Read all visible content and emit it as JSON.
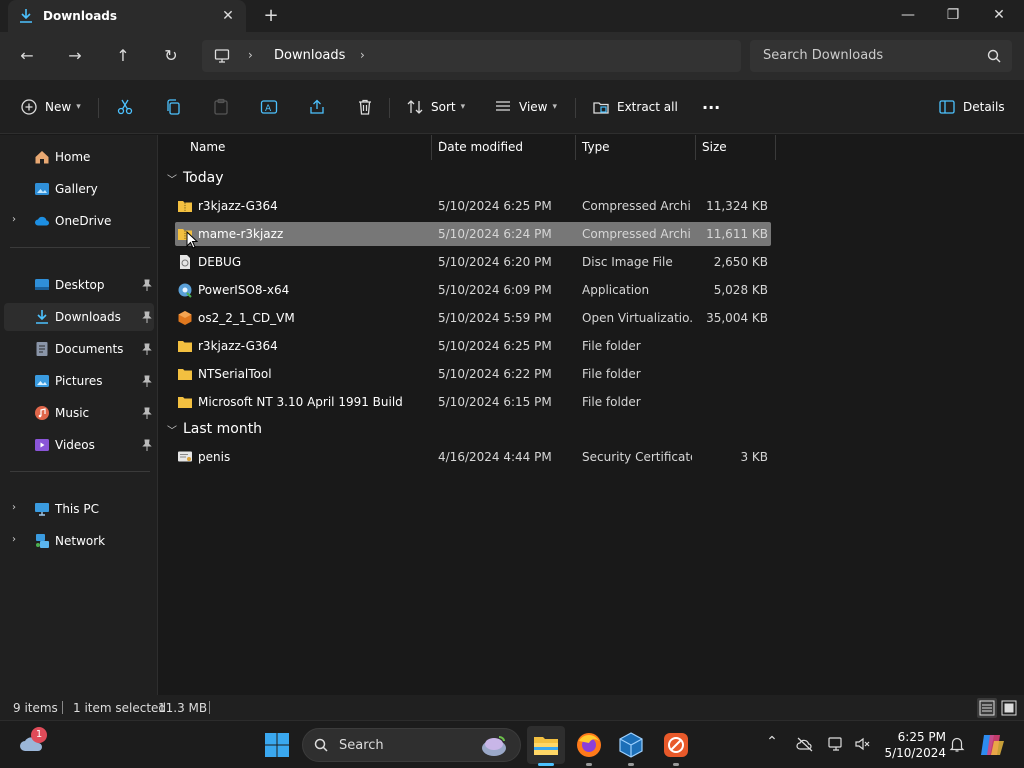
{
  "window": {
    "tab_title": "Downloads",
    "new_tab": "+",
    "close_tab": "✕",
    "minimize": "—",
    "maximize": "❐",
    "close": "✕"
  },
  "navigation": {
    "back": "←",
    "forward": "→",
    "up": "↑",
    "refresh": "↻",
    "breadcrumb": [
      "Downloads"
    ],
    "search_placeholder": "Search Downloads"
  },
  "toolbar": {
    "new_label": "New",
    "sort_label": "Sort",
    "view_label": "View",
    "extract_label": "Extract all",
    "more_label": "···",
    "details_label": "Details"
  },
  "sidebar": {
    "items": [
      {
        "label": "Home",
        "icon": "home-icon"
      },
      {
        "label": "Gallery",
        "icon": "gallery-icon"
      },
      {
        "label": "OneDrive",
        "icon": "onedrive-icon"
      },
      {
        "label": "Desktop",
        "icon": "desktop-icon"
      },
      {
        "label": "Downloads",
        "icon": "downloads-icon"
      },
      {
        "label": "Documents",
        "icon": "documents-icon"
      },
      {
        "label": "Pictures",
        "icon": "pictures-icon"
      },
      {
        "label": "Music",
        "icon": "music-icon"
      },
      {
        "label": "Videos",
        "icon": "videos-icon"
      },
      {
        "label": "This PC",
        "icon": "this-pc-icon"
      },
      {
        "label": "Network",
        "icon": "network-icon"
      }
    ]
  },
  "columns": {
    "name": "Name",
    "date": "Date modified",
    "type": "Type",
    "size": "Size"
  },
  "groups": {
    "today": "Today",
    "last_month": "Last month"
  },
  "files": [
    {
      "name": "r3kjazz-G364",
      "date": "5/10/2024 6:25 PM",
      "type": "Compressed Archi...",
      "size": "11,324 KB",
      "icon": "zip-folder-icon"
    },
    {
      "name": "mame-r3kjazz",
      "date": "5/10/2024 6:24 PM",
      "type": "Compressed Archi...",
      "size": "11,611 KB",
      "icon": "zip-folder-icon"
    },
    {
      "name": "DEBUG",
      "date": "5/10/2024 6:20 PM",
      "type": "Disc Image File",
      "size": "2,650 KB",
      "icon": "disc-image-icon"
    },
    {
      "name": "PowerISO8-x64",
      "date": "5/10/2024 6:09 PM",
      "type": "Application",
      "size": "5,028 KB",
      "icon": "application-icon"
    },
    {
      "name": "os2_2_1_CD_VM",
      "date": "5/10/2024 5:59 PM",
      "type": "Open Virtualizatio...",
      "size": "35,004 KB",
      "icon": "virtualbox-icon"
    },
    {
      "name": "r3kjazz-G364",
      "date": "5/10/2024 6:25 PM",
      "type": "File folder",
      "size": "",
      "icon": "folder-icon"
    },
    {
      "name": "NTSerialTool",
      "date": "5/10/2024 6:22 PM",
      "type": "File folder",
      "size": "",
      "icon": "folder-icon"
    },
    {
      "name": "Microsoft NT 3.10 April 1991 Build",
      "date": "5/10/2024 6:15 PM",
      "type": "File folder",
      "size": "",
      "icon": "folder-icon"
    },
    {
      "name": "penis",
      "date": "4/16/2024 4:44 PM",
      "type": "Security Certificate",
      "size": "3 KB",
      "icon": "certificate-icon"
    }
  ],
  "status": {
    "items_count": "9 items",
    "selected": "1 item selected",
    "selected_size": "11.3 MB"
  },
  "taskbar": {
    "search_label": "Search",
    "weather_badge": "1",
    "time": "6:25 PM",
    "date": "5/10/2024"
  },
  "colors": {
    "accent": "#4cc2ff",
    "folder": "#f3c040",
    "selected_row": "#777777"
  }
}
